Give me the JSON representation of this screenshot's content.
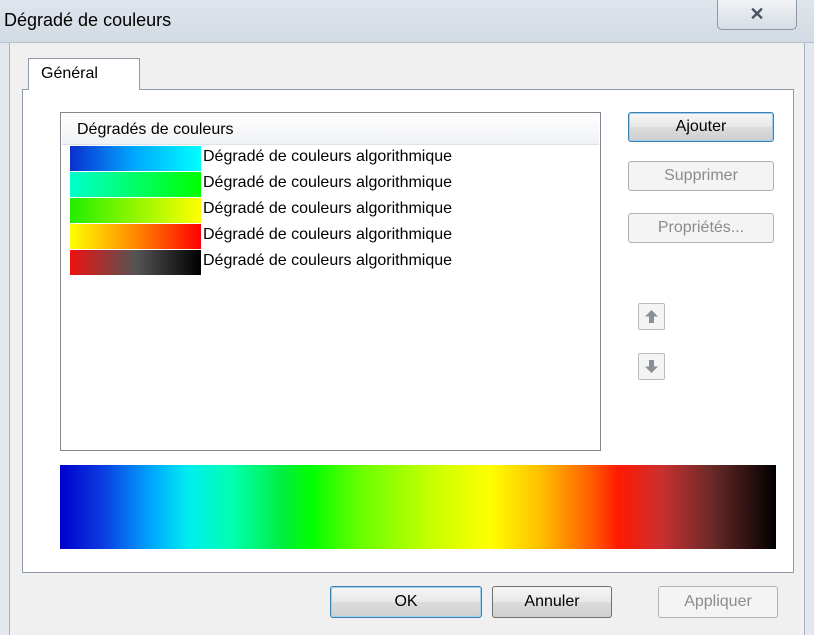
{
  "window": {
    "title": "Dégradé de couleurs",
    "close_label": "✕"
  },
  "tabs": [
    {
      "label": "Général"
    }
  ],
  "list": {
    "header": "Dégradés de couleurs",
    "items": [
      {
        "label": "Dégradé de couleurs algorithmique",
        "gradient_colors": [
          "#0a2fd0",
          "#00aaff",
          "#00ffff"
        ]
      },
      {
        "label": "Dégradé de couleurs algorithmique",
        "gradient_colors": [
          "#00ffcc",
          "#00ff00"
        ]
      },
      {
        "label": "Dégradé de couleurs algorithmique",
        "gradient_colors": [
          "#22ee00",
          "#ffff00"
        ]
      },
      {
        "label": "Dégradé de couleurs algorithmique",
        "gradient_colors": [
          "#ffff00",
          "#ff8800",
          "#ff0000"
        ]
      },
      {
        "label": "Dégradé de couleurs algorithmique",
        "gradient_colors": [
          "#ee1111",
          "#555555",
          "#000000"
        ]
      }
    ]
  },
  "side_buttons": {
    "add": "Ajouter",
    "remove": "Supprimer",
    "properties": "Propriétés..."
  },
  "move_icons": {
    "up": "arrow-up-icon",
    "down": "arrow-down-icon"
  },
  "footer_buttons": {
    "ok": "OK",
    "cancel": "Annuler",
    "apply": "Appliquer"
  }
}
